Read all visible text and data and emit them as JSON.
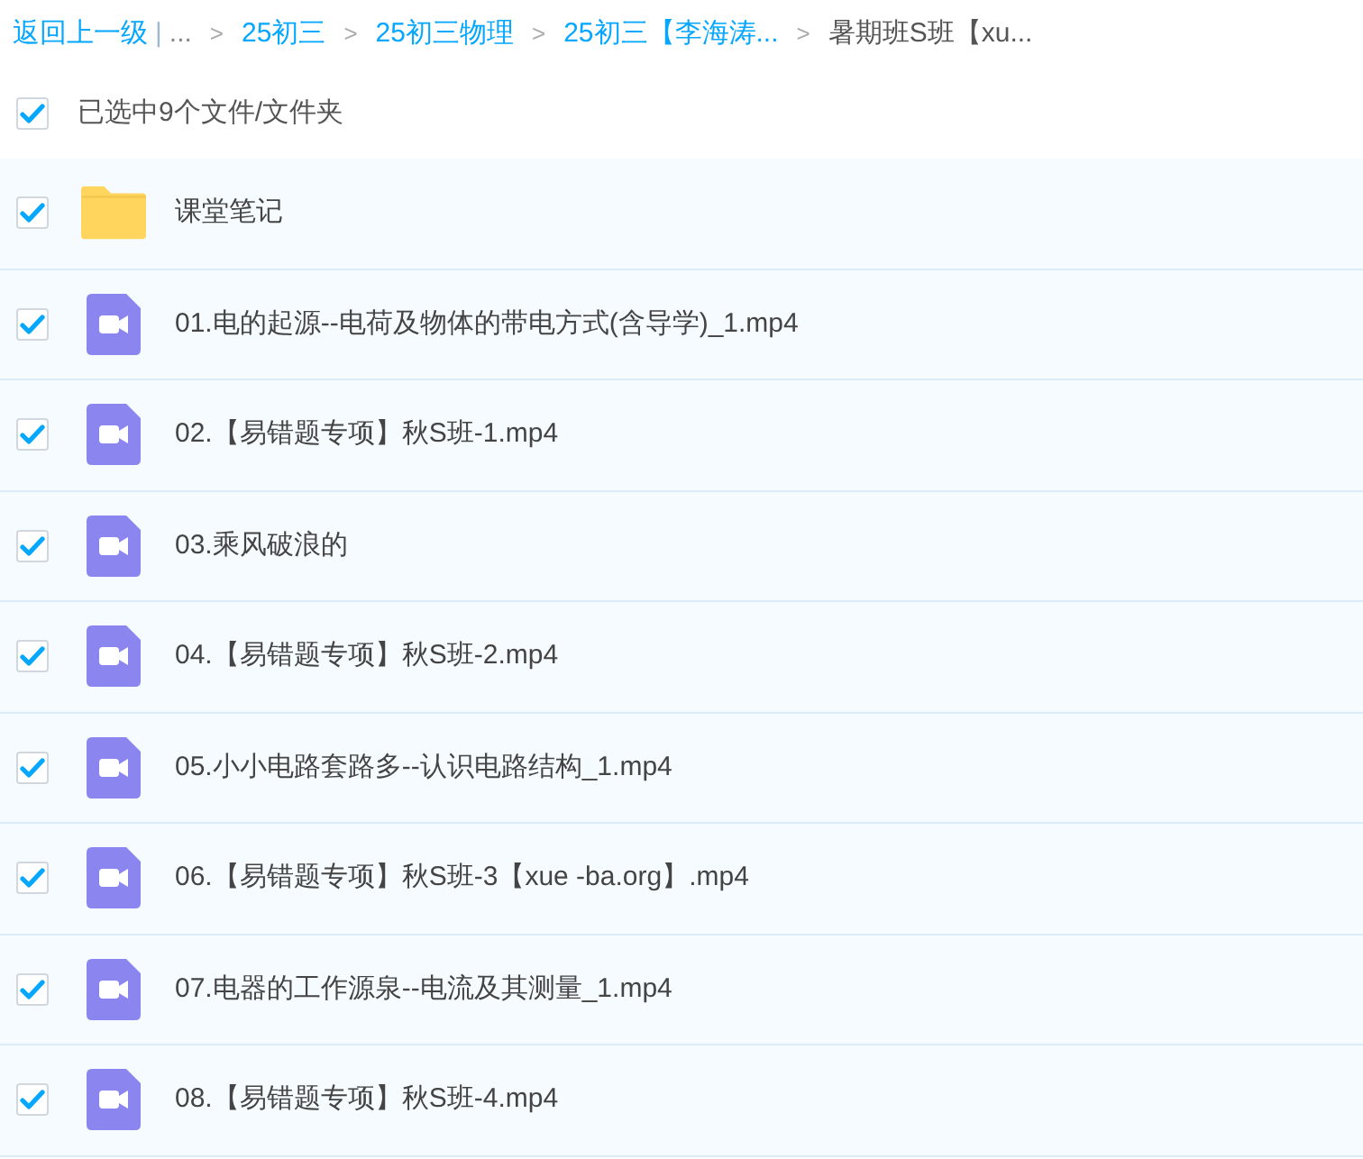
{
  "breadcrumb": {
    "back": "返回上一级",
    "separator": "|",
    "ellipsis": "...",
    "items": [
      {
        "chevron": ">",
        "label": "25初三",
        "current": false
      },
      {
        "chevron": ">",
        "label": "25初三物理",
        "current": false
      },
      {
        "chevron": ">",
        "label": "25初三【李海涛...",
        "current": false
      },
      {
        "chevron": ">",
        "label": "暑期班S班【xu...",
        "current": true
      }
    ]
  },
  "selection": {
    "label": "已选中9个文件/文件夹",
    "checked": true
  },
  "files": [
    {
      "kind": "folder",
      "name": "课堂笔记",
      "checked": true
    },
    {
      "kind": "video",
      "name": "01.电的起源--电荷及物体的带电方式(含导学)_1.mp4",
      "checked": true
    },
    {
      "kind": "video",
      "name": "02.【易错题专项】秋S班-1.mp4",
      "checked": true
    },
    {
      "kind": "video",
      "name": "03.乘风破浪的",
      "checked": true
    },
    {
      "kind": "video",
      "name": "04.【易错题专项】秋S班-2.mp4",
      "checked": true
    },
    {
      "kind": "video",
      "name": "05.小小电路套路多--认识电路结构_1.mp4",
      "checked": true
    },
    {
      "kind": "video",
      "name": "06.【易错题专项】秋S班-3【xue -ba.org】.mp4",
      "checked": true
    },
    {
      "kind": "video",
      "name": "07.电器的工作源泉--电流及其测量_1.mp4",
      "checked": true
    },
    {
      "kind": "video",
      "name": "08.【易错题专项】秋S班-4.mp4",
      "checked": true
    }
  ]
}
